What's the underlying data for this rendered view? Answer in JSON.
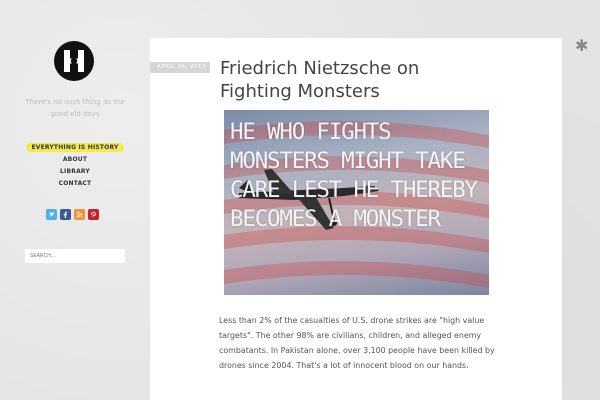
{
  "site": {
    "tagline": "There's no such thing as the good old days"
  },
  "nav": {
    "items": [
      {
        "label": "Everything is History",
        "active": true
      },
      {
        "label": "About",
        "active": false
      },
      {
        "label": "Library",
        "active": false
      },
      {
        "label": "Contact",
        "active": false
      }
    ]
  },
  "social": {
    "items": [
      {
        "icon": "twitter-icon",
        "glyph": "t",
        "color": "#4ab3e8"
      },
      {
        "icon": "facebook-icon",
        "glyph": "f",
        "color": "#3b5998"
      },
      {
        "icon": "rss-icon",
        "glyph": "r",
        "color": "#f29333"
      },
      {
        "icon": "pinterest-icon",
        "glyph": "p",
        "color": "#cb2027"
      }
    ]
  },
  "search": {
    "placeholder": "SEARCH..."
  },
  "post": {
    "date": "APRIL 26, 2013",
    "title": "Friedrich Nietzsche on Fighting Monsters",
    "image_quote": "He who fights monsters might take care lest he thereby becomes a monster",
    "excerpt": "Less than 2% of the casualties of U.S. drone strikes are \"high value targets\". The other 98% are civilians, children, and alleged enemy combatants. In Pakistan alone, over 3,100 people have been killed by drones since 2004. That's a lot of innocent blood on our hands."
  },
  "colors": {
    "accent_highlight": "#f5e94c",
    "card_bg": "#ffffff",
    "page_bg": "#e4e4e4"
  }
}
